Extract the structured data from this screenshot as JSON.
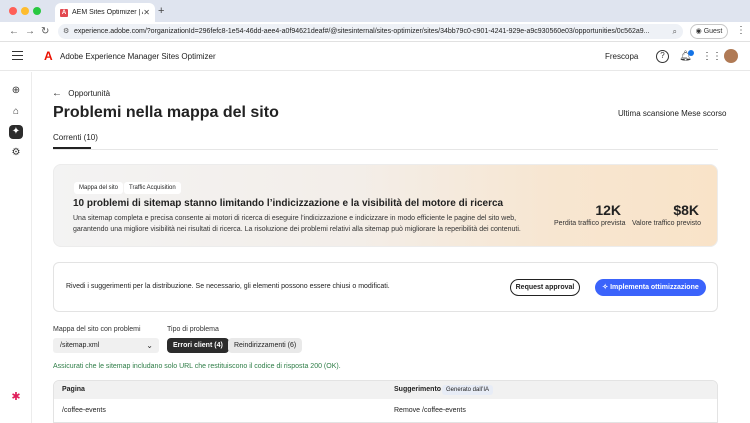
{
  "browser": {
    "tab_title": "AEM Sites Optimizer | Adobe",
    "new_tab": "+",
    "url": "experience.adobe.com/?organizationId=296fefc8-1e54-46dd-aee4-a0f94621deaf#/@sitesinternal/sites-optimizer/sites/34bb79c0-c901-4241-929e-a9c930560e03/opportunities/0c562a9...",
    "profile_label": "Guest"
  },
  "header": {
    "app_title": "Adobe Experience Manager Sites Optimizer",
    "org_name": "Frescopa"
  },
  "nav": {
    "back_label": "Opportunità"
  },
  "page": {
    "title": "Problemi nella mappa del sito",
    "last_scan": "Ultima scansione Mese scorso",
    "tab_current": "Correnti (10)"
  },
  "banner": {
    "tags": [
      "Mappa del sito",
      "Traffic Acquisition"
    ],
    "title": "10 problemi di sitemap stanno limitando l’indicizzazione e la visibilità del motore di ricerca",
    "description": "Una sitemap completa e precisa consente ai motori di ricerca di eseguire l’indicizzazione e indicizzare in modo efficiente le pagine del sito web, garantendo una migliore visibilità nei risultati di ricerca. La risoluzione dei problemi relativi alla sitemap può migliorare la reperibilità dei contenuti.",
    "stats": [
      {
        "value": "12K",
        "label": "Perdita traffico prevista"
      },
      {
        "value": "$8K",
        "label": "Valore traffico previsto"
      }
    ]
  },
  "suggestions": {
    "text": "Rivedi i suggerimenti per la distribuzione. Se necessario, gli elementi possono essere chiusi o modificati.",
    "request_label": "Request approval",
    "deploy_label": "Implementa ottimizzazione"
  },
  "filters": {
    "sitemap_label": "Mappa del sito con problemi",
    "sitemap_value": "/sitemap.xml",
    "type_label": "Tipo di problema",
    "chips": [
      "Errori client (4)",
      "Reindirizzamenti (6)"
    ]
  },
  "info_message": "Assicurati che le sitemap includano solo URL che restituiscono il codice di risposta 200 (OK).",
  "table": {
    "col_page": "Pagina",
    "col_suggestion": "Suggerimento",
    "ai_badge": "Generato dall’IA",
    "rows": [
      {
        "page": "/coffee-events",
        "suggestion": "Remove /coffee-events"
      }
    ]
  },
  "colors": {
    "accent": "#3b63fb",
    "adobe_red": "#eb1000",
    "info_green": "#2d7d46"
  }
}
